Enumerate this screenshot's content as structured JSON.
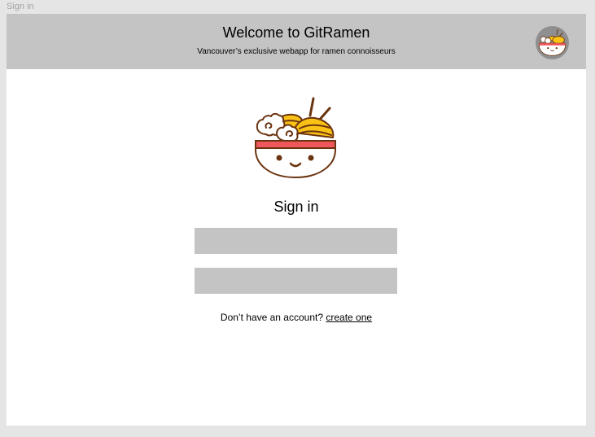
{
  "frame": {
    "label": "Sign in"
  },
  "header": {
    "title": "Welcome to GitRamen",
    "subtitle": "Vancouver’s exclusive webapp for ramen connoisseurs",
    "avatar_icon": "ramen-bowl-icon"
  },
  "main": {
    "logo_icon": "ramen-bowl-icon",
    "title": "Sign in",
    "username_field": {
      "value": "",
      "placeholder": ""
    },
    "password_field": {
      "value": "",
      "placeholder": ""
    },
    "account_prompt": "Don’t have an account?",
    "create_link_label": "create one"
  },
  "colors": {
    "page_background": "#e5e5e5",
    "frame_background": "#ffffff",
    "header_background": "#c4c4c4",
    "field_background": "#c4c4c4",
    "avatar_background": "#8f8f8f",
    "bowl_outline": "#6b3410",
    "bowl_band": "#f0575c",
    "noodles": "#fbc216"
  }
}
